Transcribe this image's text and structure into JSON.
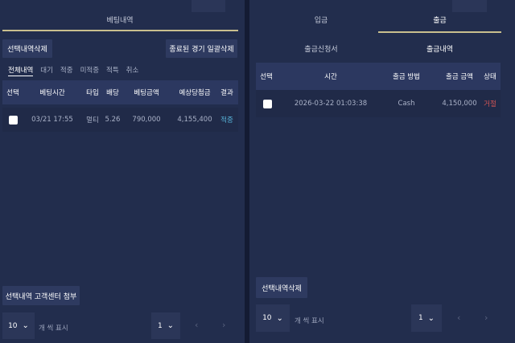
{
  "left": {
    "tab_title": "베팅내역",
    "delete_selected": "선택내역삭제",
    "bulk_delete_finished": "종료된 경기 일괄삭제",
    "filters": [
      "전체내역",
      "대기",
      "적중",
      "미적중",
      "적특",
      "취소"
    ],
    "columns": [
      "선택",
      "베팅시간",
      "타입",
      "배당",
      "베팅금액",
      "예상당첨금",
      "결과"
    ],
    "rows": [
      {
        "time": "03/21 17:55",
        "type": "멀티",
        "odds": "5.26",
        "amount": "790,000",
        "expected": "4,155,400",
        "result": "적중"
      }
    ],
    "attach_button": "선택내역 고객센터 첨부",
    "page_size": "10",
    "page_size_label": "개 씩 표시",
    "page": "1"
  },
  "right": {
    "tabs": [
      "입금",
      "출금"
    ],
    "subtabs": [
      "출금신청서",
      "출금내역"
    ],
    "columns": [
      "선택",
      "시간",
      "출금 방법",
      "출금 금액",
      "상태"
    ],
    "rows": [
      {
        "time": "2026-03-22 01:03:38",
        "method": "Cash",
        "amount": "4,150,000",
        "status": "거절"
      }
    ],
    "delete_selected": "선택내역삭제",
    "page_size": "10",
    "page_size_label": "개 씩 표시",
    "page": "1"
  },
  "colors": {
    "background": "#1a2340",
    "panel": "#222d4d",
    "accent_line": "#c9bf8e",
    "win": "#57b3d8",
    "rejected": "#d65656"
  },
  "icons": {
    "chevron": "chevron-down-icon",
    "prev": "chevron-left-icon",
    "next": "chevron-right-icon"
  }
}
